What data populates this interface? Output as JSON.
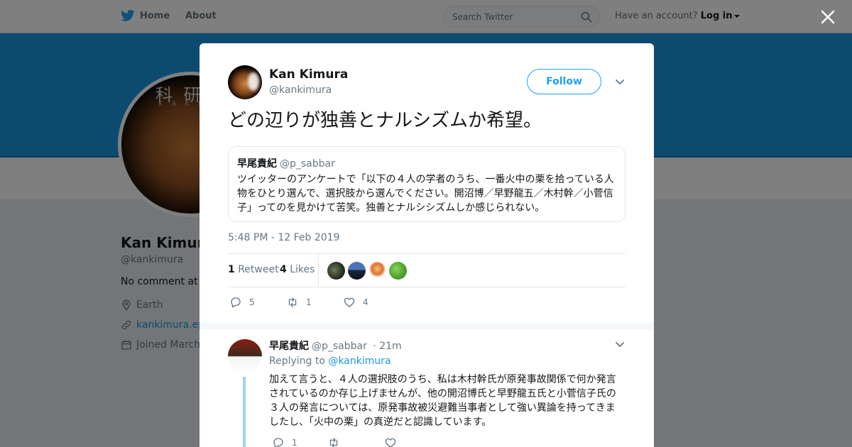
{
  "topbar": {
    "home_label": "Home",
    "about_label": "About",
    "search_placeholder": "Search Twitter",
    "account_prompt": "Have an account?",
    "login_label": "Log in"
  },
  "profile": {
    "avatar_text": "科 研",
    "avatar_subtext": "K A K E",
    "name": "Kan Kimura",
    "handle": "@kankimura",
    "bio": "No comment at all",
    "location": "Earth",
    "website": "kankimura.epiz",
    "joined": "Joined March"
  },
  "tweet": {
    "author_name": "Kan Kimura",
    "author_handle": "@kankimura",
    "follow_label": "Follow",
    "text": "どの辺りが独善とナルシズムか希望。",
    "quote": {
      "author_name": "早尾貴紀",
      "author_handle": "@p_sabbar",
      "text": "ツイッターのアンケートで「以下の４人の学者のうち、一番火中の栗を拾っている人物をひとり選んで、選択肢から選んでください。開沼博／早野龍五／木村幹／小菅信子」ってのを見かけて苦笑。独善とナルシシズムしか感じられない。"
    },
    "timestamp": "5:48 PM - 12 Feb 2019",
    "retweet_count": "1",
    "retweet_label": "Retweet",
    "like_count": "4",
    "like_label": "Likes",
    "actions": {
      "reply_count": "5",
      "retweet_count": "1",
      "like_count": "4"
    }
  },
  "reply": {
    "author_name": "早尾貴紀",
    "author_handle": "@p_sabbar",
    "time": "· 21m",
    "replying_prefix": "Replying to",
    "replying_to": "@kankimura",
    "text": "加えて言うと、４人の選択肢のうち、私は木村幹氏が原発事故関係で何か発言されているのか存じ上げませんが、他の開沼博氏と早野龍五氏と小菅信子氏の３人の発言については、原発事故被災避難当事者として強い異論を持ってきましたし、「火中の栗」の真逆だと認識しています。",
    "reply_count": "1"
  },
  "colors": {
    "brand": "#1da1f2",
    "banner": "#1b95e0",
    "muted_text": "#657786"
  }
}
